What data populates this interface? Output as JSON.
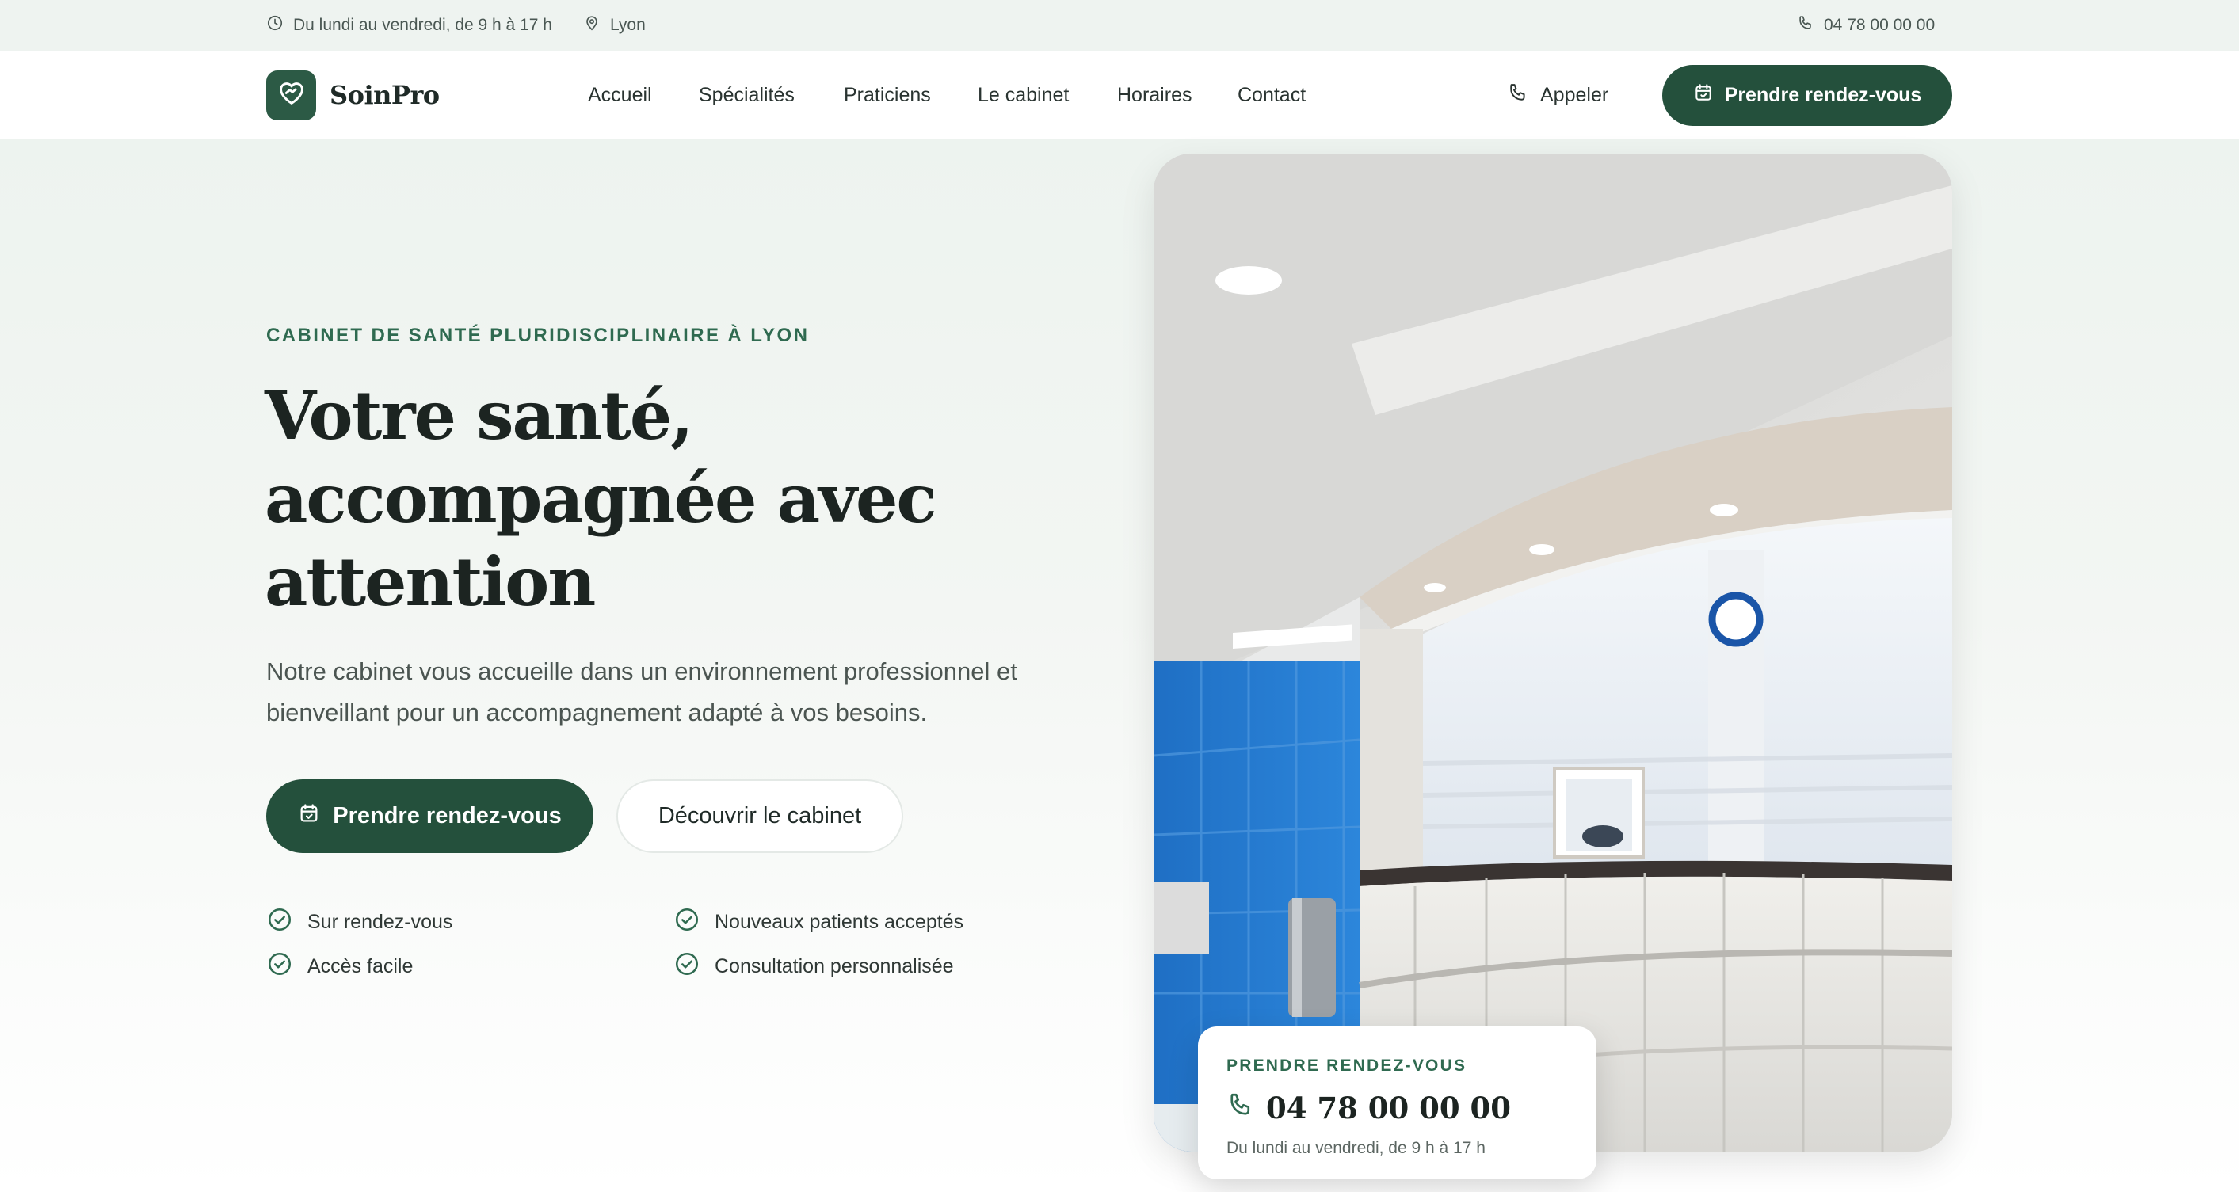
{
  "topbar": {
    "hours": "Du lundi au vendredi, de 9 h à 17 h",
    "city": "Lyon",
    "phone": "04 78 00 00 00"
  },
  "brand": {
    "name": "SoinPro",
    "color": "#2c5a45"
  },
  "nav": {
    "links": [
      "Accueil",
      "Spécialités",
      "Praticiens",
      "Le cabinet",
      "Horaires",
      "Contact"
    ],
    "call_label": "Appeler",
    "cta_label": "Prendre rendez-vous"
  },
  "hero": {
    "eyebrow": "CABINET DE SANTÉ PLURIDISCIPLINAIRE À LYON",
    "title_lines": [
      "Votre santé,",
      "accompagnée avec",
      "attention"
    ],
    "lead": "Notre cabinet vous accueille dans un environnement professionnel et bienveillant pour un accompagnement adapté à vos besoins.",
    "primary_button": "Prendre rendez-vous",
    "secondary_button": "Découvrir le cabinet",
    "features": [
      "Sur rendez-vous",
      "Nouveaux patients acceptés",
      "Accès facile",
      "Consultation personnalisée"
    ]
  },
  "appointment_card": {
    "label": "PRENDRE RENDEZ-VOUS",
    "phone": "04 78 00 00 00",
    "hours": "Du lundi au vendredi, de 9 h à 17 h"
  },
  "icons": {
    "clock": "clock-icon",
    "location": "map-pin-icon",
    "phone": "phone-icon",
    "calendar": "calendar-check-icon",
    "check": "check-circle-icon",
    "logo": "heart-handshake-icon"
  },
  "colors": {
    "accent": "#24503c",
    "eyebrow": "#2f6a50",
    "topbar_bg": "#eef3f0"
  }
}
